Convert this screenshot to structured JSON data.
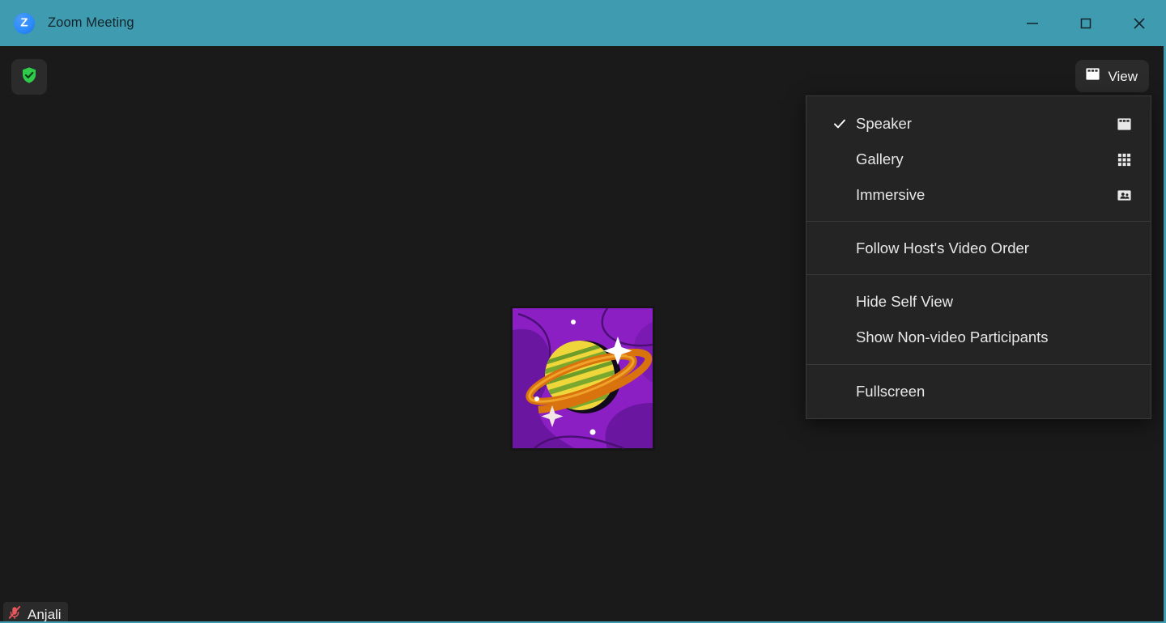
{
  "window": {
    "title": "Zoom Meeting",
    "logo_letter": "Z",
    "logo_icon": "zoom-logo-icon",
    "titlebar_color": "#3f9bb0",
    "controls": [
      {
        "name": "minimize-button",
        "icon": "minimize-icon",
        "label": "Minimize"
      },
      {
        "name": "maximize-button",
        "icon": "maximize-icon",
        "label": "Maximize"
      },
      {
        "name": "close-button",
        "icon": "close-icon",
        "label": "Close"
      }
    ]
  },
  "stage": {
    "background_color": "#1a1a1a",
    "security": {
      "icon": "shield-check-icon",
      "label": "Security",
      "color": "#2ecc4a"
    },
    "view_button": {
      "label": "View",
      "icon": "speaker-view-icon"
    },
    "participant": {
      "name": "Anjali",
      "mic_icon": "microphone-muted-icon",
      "mic_color": "#e8555a",
      "avatar_icon": "planet-saturn-illustration",
      "avatar_background": "#8b1fc4"
    }
  },
  "view_menu": {
    "groups": [
      {
        "name": "view-modes",
        "items": [
          {
            "label": "Speaker",
            "checked": true,
            "icon": "speaker-view-icon"
          },
          {
            "label": "Gallery",
            "checked": false,
            "icon": "gallery-view-icon"
          },
          {
            "label": "Immersive",
            "checked": false,
            "icon": "immersive-view-icon"
          }
        ]
      },
      {
        "name": "video-order",
        "items": [
          {
            "label": "Follow Host's Video Order",
            "checked": false,
            "icon": ""
          }
        ]
      },
      {
        "name": "visibility-toggles",
        "items": [
          {
            "label": "Hide Self View",
            "checked": false,
            "icon": ""
          },
          {
            "label": "Show Non-video Participants",
            "checked": false,
            "icon": ""
          }
        ]
      },
      {
        "name": "display-mode",
        "items": [
          {
            "label": "Fullscreen",
            "checked": false,
            "icon": ""
          }
        ]
      }
    ]
  }
}
